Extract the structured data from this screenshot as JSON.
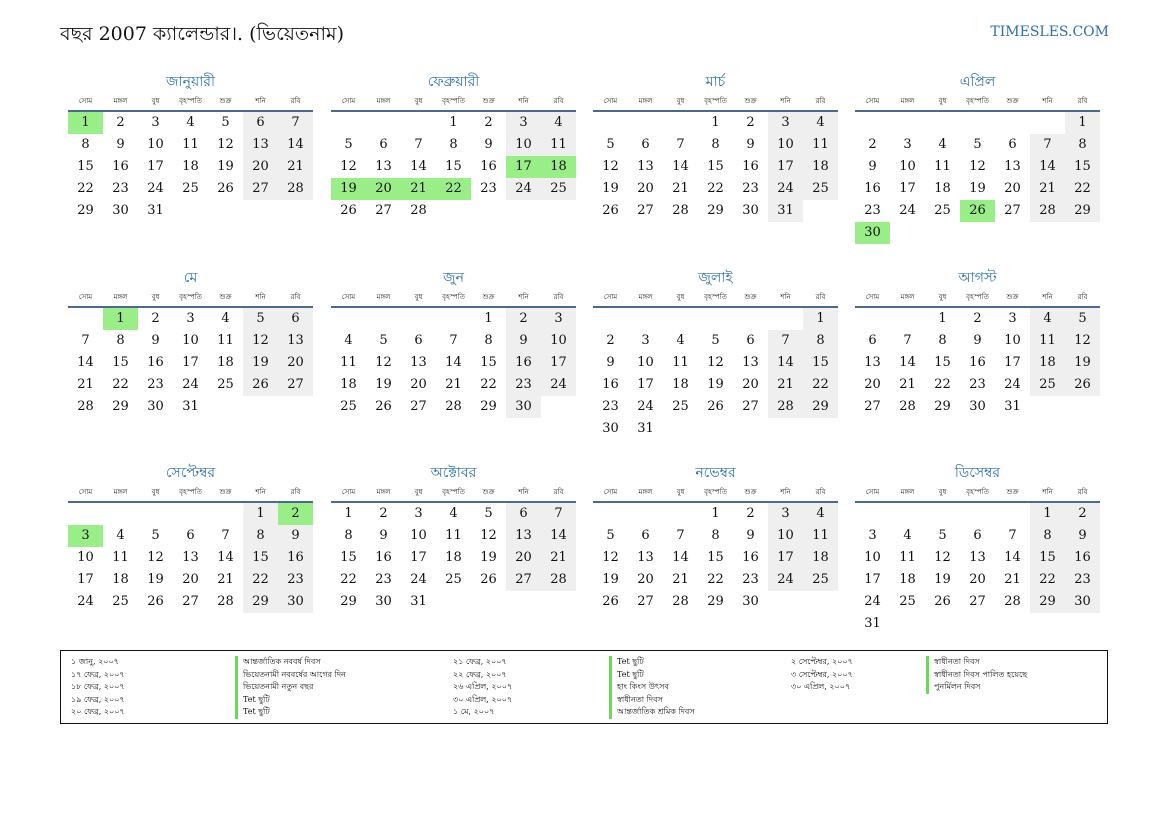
{
  "header": {
    "title": "বছর 2007 ক্যালেন্ডার।. (ভিয়েতনাম)",
    "site": "TIMESLES.COM"
  },
  "weekdays": [
    "সোম",
    "মঙ্গল",
    "বুধ",
    "বৃহস্পতি",
    "শুক্র",
    "শনি",
    "রবি"
  ],
  "colors": {
    "accent": "#2a6fb0",
    "weekend": "#efefef",
    "holiday": "#99ee88",
    "rule": "#4a6a94"
  },
  "months": [
    {
      "name": "জানুয়ারী",
      "offset": 0,
      "days": 31,
      "holidays": [
        1
      ]
    },
    {
      "name": "ফেব্রুয়ারী",
      "offset": 3,
      "days": 28,
      "holidays": [
        17,
        18,
        19,
        20,
        21,
        22
      ]
    },
    {
      "name": "মার্চ",
      "offset": 3,
      "days": 31,
      "holidays": []
    },
    {
      "name": "এপ্রিল",
      "offset": 6,
      "days": 30,
      "holidays": [
        26,
        30
      ]
    },
    {
      "name": "মে",
      "offset": 1,
      "days": 31,
      "holidays": [
        1
      ]
    },
    {
      "name": "জুন",
      "offset": 4,
      "days": 30,
      "holidays": []
    },
    {
      "name": "জুলাই",
      "offset": 6,
      "days": 31,
      "holidays": []
    },
    {
      "name": "আগস্ট",
      "offset": 2,
      "days": 31,
      "holidays": []
    },
    {
      "name": "সেপ্টেম্বর",
      "offset": 5,
      "days": 30,
      "holidays": [
        2,
        3
      ]
    },
    {
      "name": "অক্টোবর",
      "offset": 0,
      "days": 31,
      "holidays": []
    },
    {
      "name": "নভেম্বর",
      "offset": 3,
      "days": 30,
      "holidays": []
    },
    {
      "name": "ডিসেম্বর",
      "offset": 5,
      "days": 31,
      "holidays": []
    }
  ],
  "legend": [
    [
      {
        "date": "১ জানু, ২০০৭",
        "name": "আন্তর্জাতিক নববর্ষ দিবস"
      },
      {
        "date": "১৭ ফেব্র, ২০০৭",
        "name": "ভিয়েতনামী নববর্ষের আগের দিন"
      },
      {
        "date": "১৮ ফেব্র, ২০০৭",
        "name": "ভিয়েতনামী নতুন বছর"
      },
      {
        "date": "১৯ ফেব্র, ২০০৭",
        "name": "Tet ছুটি"
      },
      {
        "date": "২০ ফেব্র, ২০০৭",
        "name": "Tet ছুটি"
      }
    ],
    [
      {
        "date": "২১ ফেব্র, ২০০৭",
        "name": "Tet ছুটি"
      },
      {
        "date": "২২ ফেব্র, ২০০৭",
        "name": "Tet ছুটি"
      },
      {
        "date": "২৬ এপ্রিল, ২০০৭",
        "name": "হাং কিংস উৎসব"
      },
      {
        "date": "৩০ এপ্রিল, ২০০৭",
        "name": "স্বাধীনতা দিবস"
      },
      {
        "date": "১ মে, ২০০৭",
        "name": "আন্তর্জাতিক শ্রমিক দিবস"
      }
    ],
    [
      {
        "date": "২ সেপ্টেম্বর, ২০০৭",
        "name": "স্বাধীনতা দিবস"
      },
      {
        "date": "৩ সেপ্টেম্বর, ২০০৭",
        "name": "স্বাধীনতা দিবস পালিত হয়েছে"
      },
      {
        "date": "৩০ এপ্রিল, ২০০৭",
        "name": "পুনর্মিলন দিবস"
      }
    ]
  ]
}
